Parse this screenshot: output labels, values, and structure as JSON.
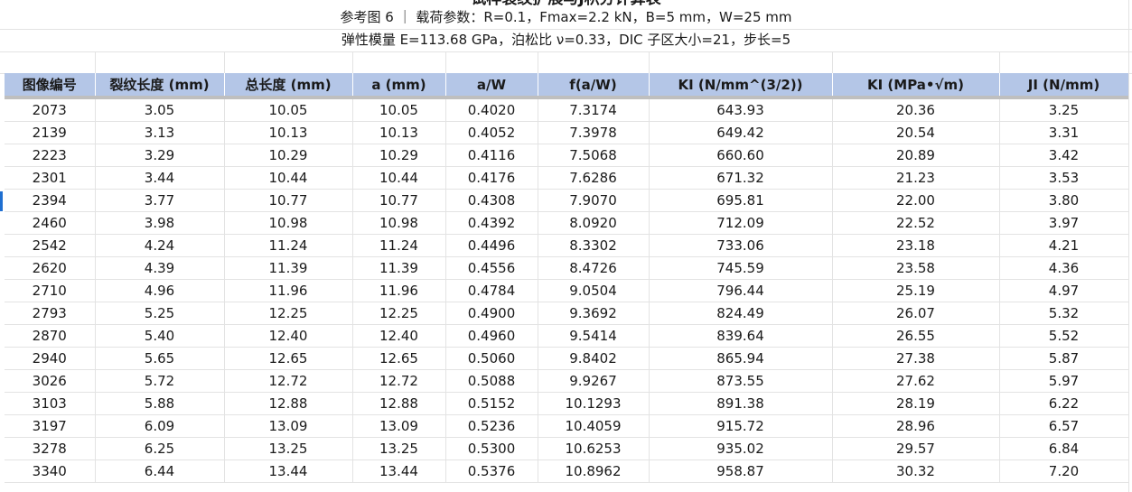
{
  "sheet": {
    "title_clipped": "试样裂纹扩展与J积分计算表",
    "subtitle_1": "参考图 6 ｜ 载荷参数：R=0.1，Fmax=2.2 kN，B=5 mm，W=25 mm",
    "subtitle_2": "弹性模量 E=113.68 GPa，泊松比 ν=0.33，DIC 子区大小=21，步长=5"
  },
  "table": {
    "headers": [
      "图像编号",
      "裂纹长度 (mm)",
      "总长度 (mm)",
      "a (mm)",
      "a/W",
      "f(a/W)",
      "KI (N/mm^(3/2))",
      "KI (MPa•√m)",
      "JI (N/mm)"
    ],
    "rows": [
      [
        "2073",
        "3.05",
        "10.05",
        "10.05",
        "0.4020",
        "7.3174",
        "643.93",
        "20.36",
        "3.25"
      ],
      [
        "2139",
        "3.13",
        "10.13",
        "10.13",
        "0.4052",
        "7.3978",
        "649.42",
        "20.54",
        "3.31"
      ],
      [
        "2223",
        "3.29",
        "10.29",
        "10.29",
        "0.4116",
        "7.5068",
        "660.60",
        "20.89",
        "3.42"
      ],
      [
        "2301",
        "3.44",
        "10.44",
        "10.44",
        "0.4176",
        "7.6286",
        "671.32",
        "21.23",
        "3.53"
      ],
      [
        "2394",
        "3.77",
        "10.77",
        "10.77",
        "0.4308",
        "7.9070",
        "695.81",
        "22.00",
        "3.80"
      ],
      [
        "2460",
        "3.98",
        "10.98",
        "10.98",
        "0.4392",
        "8.0920",
        "712.09",
        "22.52",
        "3.97"
      ],
      [
        "2542",
        "4.24",
        "11.24",
        "11.24",
        "0.4496",
        "8.3302",
        "733.06",
        "23.18",
        "4.21"
      ],
      [
        "2620",
        "4.39",
        "11.39",
        "11.39",
        "0.4556",
        "8.4726",
        "745.59",
        "23.58",
        "4.36"
      ],
      [
        "2710",
        "4.96",
        "11.96",
        "11.96",
        "0.4784",
        "9.0504",
        "796.44",
        "25.19",
        "4.97"
      ],
      [
        "2793",
        "5.25",
        "12.25",
        "12.25",
        "0.4900",
        "9.3692",
        "824.49",
        "26.07",
        "5.32"
      ],
      [
        "2870",
        "5.40",
        "12.40",
        "12.40",
        "0.4960",
        "9.5414",
        "839.64",
        "26.55",
        "5.52"
      ],
      [
        "2940",
        "5.65",
        "12.65",
        "12.65",
        "0.5060",
        "9.8402",
        "865.94",
        "27.38",
        "5.87"
      ],
      [
        "3026",
        "5.72",
        "12.72",
        "12.72",
        "0.5088",
        "9.9267",
        "873.55",
        "27.62",
        "5.97"
      ],
      [
        "3103",
        "5.88",
        "12.88",
        "12.88",
        "0.5152",
        "10.1293",
        "891.38",
        "28.19",
        "6.22"
      ],
      [
        "3197",
        "6.09",
        "13.09",
        "13.09",
        "0.5236",
        "10.4059",
        "915.72",
        "28.96",
        "6.57"
      ],
      [
        "3278",
        "6.25",
        "13.25",
        "13.25",
        "0.5300",
        "10.6253",
        "935.02",
        "29.57",
        "6.84"
      ],
      [
        "3340",
        "6.44",
        "13.44",
        "13.44",
        "0.5376",
        "10.8962",
        "958.87",
        "30.32",
        "7.20"
      ]
    ]
  },
  "colors": {
    "header_fill": "#b4c6e7",
    "grid_line": "#e3e3e3",
    "selection": "#1f6fd1"
  }
}
